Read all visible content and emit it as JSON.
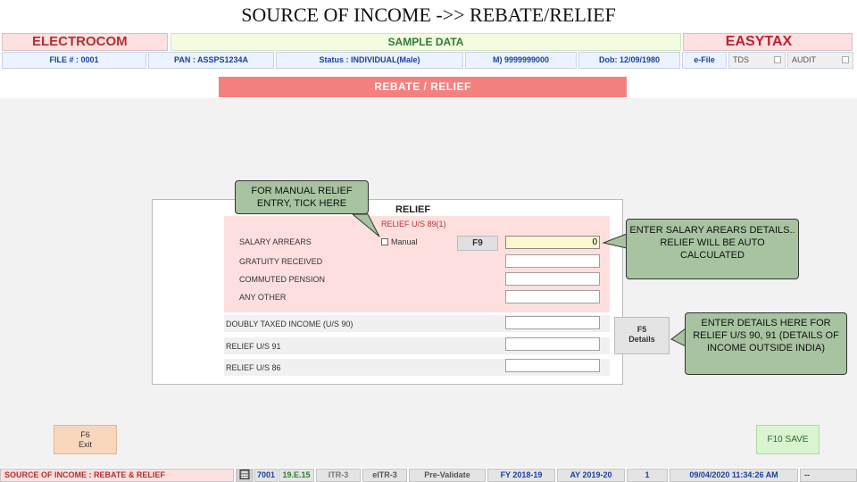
{
  "slide_title": "SOURCE OF INCOME ->> REBATE/RELIEF",
  "header": {
    "brand_left": "ELECTROCOM",
    "sample": "SAMPLE DATA",
    "brand_right": "EASYTAX"
  },
  "info_bar": {
    "file": "FILE # : 0001",
    "pan": "PAN : ASSPS1234A",
    "status": "Status : INDIVIDUAL(Male)",
    "mobile": "M) 9999999000",
    "dob": "Dob: 12/09/1980",
    "efile": "e-File",
    "tds": "TDS",
    "audit": "AUDIT"
  },
  "section_header": "REBATE / RELIEF",
  "relief": {
    "title": "RELIEF",
    "s89_title": "RELIEF U/S 89(1)",
    "salary_arrears_label": "SALARY ARREARS",
    "manual_label": "Manual",
    "f9_label": "F9",
    "salary_arrears_value": "0",
    "gratuity_label": "GRATUITY RECEIVED",
    "commuted_label": "COMMUTED PENSION",
    "any_other_label": "ANY OTHER",
    "doubly_taxed_label": "DOUBLY TAXED INCOME (U/S 90)",
    "relief91_label": "RELIEF U/S 91",
    "relief86_label": "RELIEF U/S 86",
    "f5_line1": "F5",
    "f5_line2": "Details"
  },
  "callouts": {
    "manual": "FOR MANUAL RELIEF ENTRY, TICK HERE",
    "salary": "ENTER SALARY AREARS DETAILS.. RELIEF WILL BE AUTO CALCULATED",
    "details": "ENTER DETAILS HERE FOR RELIEF U/S 90, 91 (DETAILS OF INCOME OUTSIDE INDIA)"
  },
  "buttons": {
    "f6_line1": "F6",
    "f6_line2": "Exit",
    "f10": "F10  SAVE"
  },
  "status_bar": {
    "section": "SOURCE OF INCOME : REBATE & RELIEF",
    "code": "7001",
    "version": "19.E.15",
    "itr3": "ITR-3",
    "eitr3": "eITR-3",
    "prevalidate": "Pre-Validate",
    "fy": "FY 2018-19",
    "ay": "AY 2019-20",
    "count": "1",
    "datetime": "09/04/2020 11:34:26 AM",
    "dash": "--"
  },
  "colors": {
    "header_bar": "#f58080",
    "s89_panel": "#fde0de",
    "callout": "#a8c3a0"
  }
}
